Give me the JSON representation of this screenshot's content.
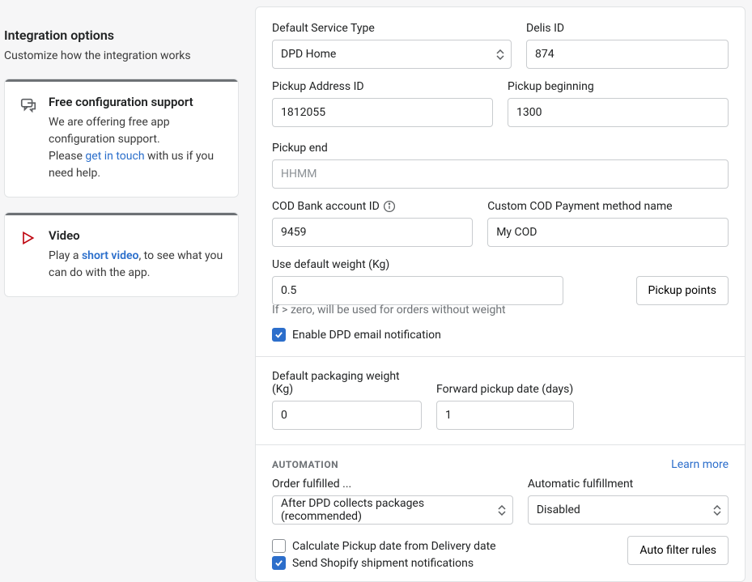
{
  "left": {
    "title": "Integration options",
    "subtitle": "Customize how the integration works",
    "support": {
      "title": "Free configuration support",
      "line1": "We are offering free app configuration support.",
      "line2a": "Please ",
      "link": "get in touch",
      "line2b": " with us if you need help."
    },
    "video": {
      "title": "Video",
      "line1a": "Play a ",
      "link": "short video",
      "line1b": ", to see what you can do with the app."
    }
  },
  "form": {
    "serviceType": {
      "label": "Default Service Type",
      "value": "DPD Home"
    },
    "delisId": {
      "label": "Delis ID",
      "value": "874"
    },
    "pickupAddressId": {
      "label": "Pickup Address ID",
      "value": "1812055"
    },
    "pickupBeginning": {
      "label": "Pickup beginning",
      "value": "1300"
    },
    "pickupEnd": {
      "label": "Pickup end",
      "value": "",
      "placeholder": "HHMM"
    },
    "codBank": {
      "label": "COD Bank account ID",
      "value": "9459"
    },
    "customCod": {
      "label": "Custom COD Payment method name",
      "value": "My COD"
    },
    "defaultWeight": {
      "label": "Use default weight (Kg)",
      "value": "0.5",
      "help": "If > zero, will be used for orders without weight"
    },
    "pickupPointsBtn": "Pickup points",
    "enableEmail": {
      "label": "Enable DPD email notification",
      "checked": true
    },
    "packagingWeight": {
      "label": "Default packaging weight (Kg)",
      "value": "0"
    },
    "forwardPickup": {
      "label": "Forward pickup date (days)",
      "value": "1"
    },
    "automation": {
      "title": "AUTOMATION",
      "learnMore": "Learn more",
      "orderFulfilled": {
        "label": "Order fulfilled ...",
        "value": "After DPD collects packages (recommended)"
      },
      "autoFulfillment": {
        "label": "Automatic fulfillment",
        "value": "Disabled"
      },
      "calcPickup": {
        "label": "Calculate Pickup date from Delivery date",
        "checked": false
      },
      "sendNotif": {
        "label": "Send Shopify shipment notifications",
        "checked": true
      },
      "autoFilterBtn": "Auto filter rules"
    }
  }
}
